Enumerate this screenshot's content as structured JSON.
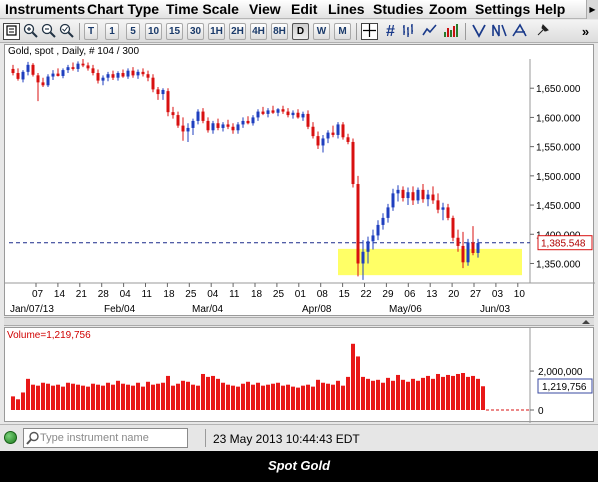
{
  "menu": [
    "Instruments",
    "Chart Type",
    "Time Scale",
    "View",
    "Edit",
    "Lines",
    "Studies",
    "Zoom",
    "Settings",
    "Help"
  ],
  "toolbar": {
    "periods": [
      "T",
      "1",
      "5",
      "10",
      "15",
      "30",
      "1H",
      "2H",
      "4H",
      "8H",
      "D",
      "W",
      "M"
    ],
    "active_period": "D"
  },
  "chart": {
    "title": "Gold, spot , Daily, # 104 / 300",
    "current_price_label": "1,385.548",
    "current_price": 1385.548,
    "y_ticks": [
      "1,650.000",
      "1,600.000",
      "1,550.000",
      "1,500.000",
      "1,450.000",
      "1,400.000",
      "1,350.000"
    ],
    "x_day_ticks": [
      "07",
      "14",
      "21",
      "28",
      "04",
      "11",
      "18",
      "25",
      "04",
      "11",
      "18",
      "25",
      "01",
      "08",
      "15",
      "22",
      "29",
      "06",
      "13",
      "20",
      "27",
      "03",
      "10"
    ],
    "x_month_labels": [
      "Jan/07/13",
      "Feb/04",
      "Mar/04",
      "Apr/08",
      "May/06",
      "Jun/03"
    ],
    "highlight_zone": {
      "low": 1330,
      "high": 1375
    }
  },
  "volume": {
    "label": "Volume=1,219,756",
    "current_label": "1,219,756",
    "y_ticks": [
      "2,000,000",
      "0"
    ]
  },
  "statusbar": {
    "search_placeholder": "Type instrument name",
    "timestamp": "23 May 2013 10:44:43 EDT"
  },
  "caption": "Spot Gold",
  "colors": {
    "up": "#1f3fbf",
    "down": "#d81010",
    "highlight": "#ffff66",
    "volume": "#e81818",
    "price_line": "#1a2a8a"
  },
  "chart_data": {
    "type": "candlestick",
    "title": "Gold, spot , Daily",
    "ylim": [
      1320,
      1700
    ],
    "candles": [
      {
        "o": 1683,
        "h": 1690,
        "l": 1672,
        "c": 1676
      },
      {
        "o": 1676,
        "h": 1684,
        "l": 1663,
        "c": 1666
      },
      {
        "o": 1665,
        "h": 1681,
        "l": 1660,
        "c": 1678
      },
      {
        "o": 1678,
        "h": 1695,
        "l": 1672,
        "c": 1690
      },
      {
        "o": 1690,
        "h": 1693,
        "l": 1670,
        "c": 1673
      },
      {
        "o": 1672,
        "h": 1676,
        "l": 1628,
        "c": 1660
      },
      {
        "o": 1660,
        "h": 1668,
        "l": 1652,
        "c": 1655
      },
      {
        "o": 1655,
        "h": 1674,
        "l": 1652,
        "c": 1670
      },
      {
        "o": 1670,
        "h": 1681,
        "l": 1664,
        "c": 1675
      },
      {
        "o": 1675,
        "h": 1684,
        "l": 1670,
        "c": 1671
      },
      {
        "o": 1671,
        "h": 1684,
        "l": 1667,
        "c": 1681
      },
      {
        "o": 1681,
        "h": 1690,
        "l": 1676,
        "c": 1686
      },
      {
        "o": 1686,
        "h": 1694,
        "l": 1680,
        "c": 1683
      },
      {
        "o": 1683,
        "h": 1696,
        "l": 1678,
        "c": 1692
      },
      {
        "o": 1692,
        "h": 1700,
        "l": 1686,
        "c": 1689
      },
      {
        "o": 1689,
        "h": 1694,
        "l": 1680,
        "c": 1684
      },
      {
        "o": 1684,
        "h": 1690,
        "l": 1672,
        "c": 1676
      },
      {
        "o": 1676,
        "h": 1682,
        "l": 1658,
        "c": 1663
      },
      {
        "o": 1663,
        "h": 1672,
        "l": 1655,
        "c": 1668
      },
      {
        "o": 1668,
        "h": 1678,
        "l": 1662,
        "c": 1674
      },
      {
        "o": 1674,
        "h": 1680,
        "l": 1664,
        "c": 1668
      },
      {
        "o": 1668,
        "h": 1679,
        "l": 1663,
        "c": 1676
      },
      {
        "o": 1676,
        "h": 1682,
        "l": 1668,
        "c": 1670
      },
      {
        "o": 1670,
        "h": 1684,
        "l": 1666,
        "c": 1680
      },
      {
        "o": 1680,
        "h": 1686,
        "l": 1668,
        "c": 1672
      },
      {
        "o": 1672,
        "h": 1682,
        "l": 1666,
        "c": 1678
      },
      {
        "o": 1678,
        "h": 1684,
        "l": 1670,
        "c": 1674
      },
      {
        "o": 1674,
        "h": 1680,
        "l": 1662,
        "c": 1668
      },
      {
        "o": 1668,
        "h": 1674,
        "l": 1643,
        "c": 1648
      },
      {
        "o": 1648,
        "h": 1652,
        "l": 1630,
        "c": 1640
      },
      {
        "o": 1640,
        "h": 1650,
        "l": 1630,
        "c": 1647
      },
      {
        "o": 1645,
        "h": 1650,
        "l": 1602,
        "c": 1609
      },
      {
        "o": 1609,
        "h": 1618,
        "l": 1598,
        "c": 1604
      },
      {
        "o": 1604,
        "h": 1610,
        "l": 1582,
        "c": 1586
      },
      {
        "o": 1586,
        "h": 1600,
        "l": 1560,
        "c": 1576
      },
      {
        "o": 1576,
        "h": 1590,
        "l": 1558,
        "c": 1582
      },
      {
        "o": 1582,
        "h": 1598,
        "l": 1570,
        "c": 1594
      },
      {
        "o": 1594,
        "h": 1614,
        "l": 1588,
        "c": 1610
      },
      {
        "o": 1610,
        "h": 1616,
        "l": 1590,
        "c": 1594
      },
      {
        "o": 1594,
        "h": 1600,
        "l": 1574,
        "c": 1578
      },
      {
        "o": 1578,
        "h": 1594,
        "l": 1572,
        "c": 1590
      },
      {
        "o": 1590,
        "h": 1598,
        "l": 1578,
        "c": 1582
      },
      {
        "o": 1582,
        "h": 1592,
        "l": 1576,
        "c": 1588
      },
      {
        "o": 1588,
        "h": 1596,
        "l": 1580,
        "c": 1584
      },
      {
        "o": 1584,
        "h": 1590,
        "l": 1572,
        "c": 1578
      },
      {
        "o": 1578,
        "h": 1592,
        "l": 1572,
        "c": 1588
      },
      {
        "o": 1588,
        "h": 1600,
        "l": 1582,
        "c": 1594
      },
      {
        "o": 1594,
        "h": 1602,
        "l": 1588,
        "c": 1590
      },
      {
        "o": 1590,
        "h": 1604,
        "l": 1586,
        "c": 1600
      },
      {
        "o": 1600,
        "h": 1614,
        "l": 1594,
        "c": 1610
      },
      {
        "o": 1610,
        "h": 1618,
        "l": 1604,
        "c": 1606
      },
      {
        "o": 1606,
        "h": 1616,
        "l": 1600,
        "c": 1612
      },
      {
        "o": 1612,
        "h": 1620,
        "l": 1606,
        "c": 1608
      },
      {
        "o": 1608,
        "h": 1616,
        "l": 1602,
        "c": 1614
      },
      {
        "o": 1614,
        "h": 1620,
        "l": 1606,
        "c": 1610
      },
      {
        "o": 1610,
        "h": 1616,
        "l": 1600,
        "c": 1604
      },
      {
        "o": 1604,
        "h": 1612,
        "l": 1598,
        "c": 1608
      },
      {
        "o": 1608,
        "h": 1614,
        "l": 1598,
        "c": 1600
      },
      {
        "o": 1600,
        "h": 1610,
        "l": 1594,
        "c": 1606
      },
      {
        "o": 1606,
        "h": 1612,
        "l": 1580,
        "c": 1584
      },
      {
        "o": 1584,
        "h": 1592,
        "l": 1564,
        "c": 1568
      },
      {
        "o": 1568,
        "h": 1576,
        "l": 1546,
        "c": 1552
      },
      {
        "o": 1552,
        "h": 1570,
        "l": 1540,
        "c": 1564
      },
      {
        "o": 1564,
        "h": 1578,
        "l": 1556,
        "c": 1574
      },
      {
        "o": 1574,
        "h": 1586,
        "l": 1566,
        "c": 1570
      },
      {
        "o": 1570,
        "h": 1592,
        "l": 1564,
        "c": 1588
      },
      {
        "o": 1588,
        "h": 1592,
        "l": 1562,
        "c": 1566
      },
      {
        "o": 1566,
        "h": 1572,
        "l": 1554,
        "c": 1558
      },
      {
        "o": 1558,
        "h": 1564,
        "l": 1480,
        "c": 1486
      },
      {
        "o": 1486,
        "h": 1500,
        "l": 1328,
        "c": 1350
      },
      {
        "o": 1350,
        "h": 1390,
        "l": 1322,
        "c": 1370
      },
      {
        "o": 1370,
        "h": 1396,
        "l": 1350,
        "c": 1388
      },
      {
        "o": 1388,
        "h": 1408,
        "l": 1374,
        "c": 1398
      },
      {
        "o": 1398,
        "h": 1424,
        "l": 1390,
        "c": 1416
      },
      {
        "o": 1416,
        "h": 1436,
        "l": 1408,
        "c": 1428
      },
      {
        "o": 1428,
        "h": 1452,
        "l": 1420,
        "c": 1446
      },
      {
        "o": 1446,
        "h": 1478,
        "l": 1440,
        "c": 1470
      },
      {
        "o": 1470,
        "h": 1484,
        "l": 1456,
        "c": 1476
      },
      {
        "o": 1476,
        "h": 1482,
        "l": 1456,
        "c": 1462
      },
      {
        "o": 1462,
        "h": 1480,
        "l": 1450,
        "c": 1472
      },
      {
        "o": 1472,
        "h": 1482,
        "l": 1450,
        "c": 1458
      },
      {
        "o": 1458,
        "h": 1480,
        "l": 1452,
        "c": 1476
      },
      {
        "o": 1476,
        "h": 1486,
        "l": 1454,
        "c": 1460
      },
      {
        "o": 1460,
        "h": 1476,
        "l": 1448,
        "c": 1468
      },
      {
        "o": 1468,
        "h": 1482,
        "l": 1452,
        "c": 1458
      },
      {
        "o": 1458,
        "h": 1470,
        "l": 1436,
        "c": 1442
      },
      {
        "o": 1442,
        "h": 1454,
        "l": 1424,
        "c": 1446
      },
      {
        "o": 1446,
        "h": 1452,
        "l": 1424,
        "c": 1428
      },
      {
        "o": 1428,
        "h": 1432,
        "l": 1388,
        "c": 1394
      },
      {
        "o": 1394,
        "h": 1408,
        "l": 1370,
        "c": 1380
      },
      {
        "o": 1380,
        "h": 1404,
        "l": 1342,
        "c": 1352
      },
      {
        "o": 1352,
        "h": 1392,
        "l": 1346,
        "c": 1386
      },
      {
        "o": 1386,
        "h": 1414,
        "l": 1364,
        "c": 1368
      },
      {
        "o": 1368,
        "h": 1392,
        "l": 1360,
        "c": 1385
      }
    ],
    "volume": [
      700000,
      550000,
      900000,
      1600000,
      1300000,
      1250000,
      1400000,
      1350000,
      1250000,
      1300000,
      1200000,
      1400000,
      1350000,
      1300000,
      1250000,
      1200000,
      1350000,
      1300000,
      1250000,
      1400000,
      1300000,
      1500000,
      1350000,
      1300000,
      1250000,
      1400000,
      1200000,
      1450000,
      1300000,
      1350000,
      1400000,
      1750000,
      1250000,
      1350000,
      1500000,
      1450000,
      1300000,
      1250000,
      1850000,
      1700000,
      1750000,
      1600000,
      1400000,
      1300000,
      1250000,
      1200000,
      1350000,
      1450000,
      1300000,
      1400000,
      1250000,
      1300000,
      1350000,
      1400000,
      1250000,
      1300000,
      1200000,
      1150000,
      1250000,
      1300000,
      1200000,
      1550000,
      1400000,
      1350000,
      1300000,
      1500000,
      1250000,
      1700000,
      3400000,
      2750000,
      1700000,
      1600000,
      1500000,
      1550000,
      1400000,
      1650000,
      1500000,
      1800000,
      1550000,
      1450000,
      1600000,
      1500000,
      1650000,
      1750000,
      1600000,
      1850000,
      1700000,
      1800000,
      1750000,
      1850000,
      1900000,
      1700000,
      1750000,
      1600000,
      1219756
    ],
    "volume_ylim": [
      0,
      3800000
    ]
  }
}
